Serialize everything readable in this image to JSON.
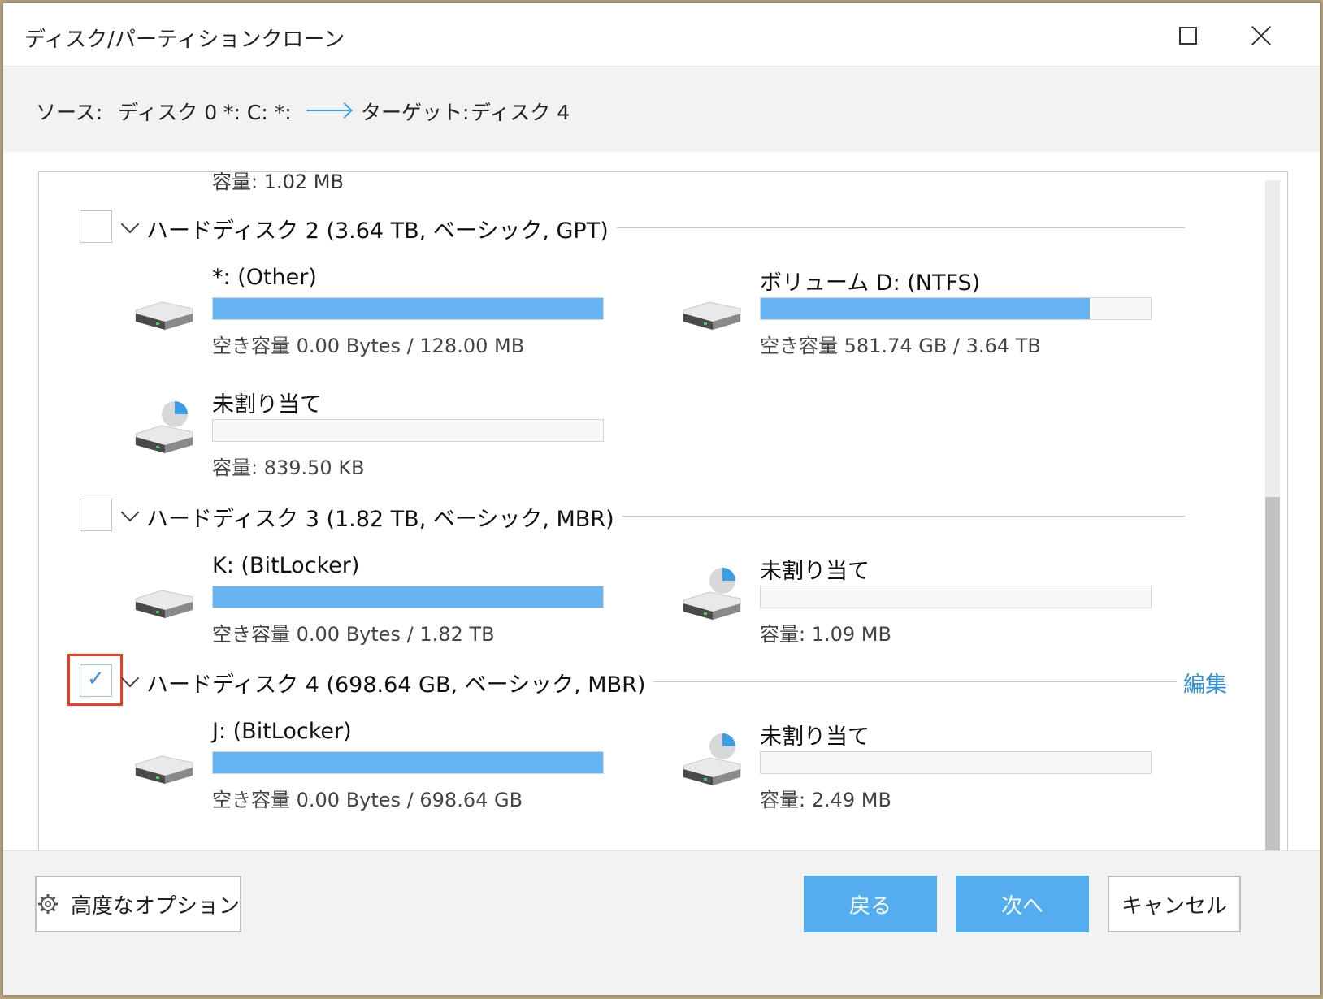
{
  "window": {
    "title": "ディスク/パーティションクローン"
  },
  "header": {
    "source_label": "ソース:",
    "source_value": "ディスク 0 *: C: *:",
    "target_label": "ターゲット:",
    "target_value": "ディスク 4"
  },
  "list": {
    "cut_text": "容量: 1.02 MB",
    "disks": [
      {
        "title": "ハードディスク 2 (3.64 TB, ベーシック, GPT)",
        "checked": false,
        "partitions": [
          {
            "name": "*: (Other)",
            "info": "空き容量 0.00 Bytes / 128.00 MB",
            "used_fraction": 1.0
          },
          {
            "name": "ボリューム D: (NTFS)",
            "info": "空き容量 581.74 GB / 3.64 TB",
            "used_fraction": 0.844
          },
          {
            "name": "未割り当て",
            "info": "容量: 839.50 KB",
            "used_fraction": 0.0
          }
        ]
      },
      {
        "title": "ハードディスク 3 (1.82 TB, ベーシック, MBR)",
        "checked": false,
        "partitions": [
          {
            "name": "K: (BitLocker)",
            "info": "空き容量 0.00 Bytes / 1.82 TB",
            "used_fraction": 1.0
          },
          {
            "name": "未割り当て",
            "info": "容量: 1.09 MB",
            "used_fraction": 0.0
          }
        ]
      },
      {
        "title": "ハードディスク 4 (698.64 GB, ベーシック, MBR)",
        "checked": true,
        "edit_label": "編集",
        "partitions": [
          {
            "name": "J: (BitLocker)",
            "info": "空き容量 0.00 Bytes / 698.64 GB",
            "used_fraction": 1.0
          },
          {
            "name": "未割り当て",
            "info": "容量: 2.49 MB",
            "used_fraction": 0.0
          }
        ]
      }
    ]
  },
  "footer": {
    "advanced_label": "高度なオプション",
    "back_label": "戻る",
    "next_label": "次へ",
    "cancel_label": "キャンセル"
  },
  "colors": {
    "accent": "#54adef",
    "bar_fill": "#66b5f2",
    "highlight": "#f03c18",
    "link": "#2e8fe0"
  }
}
